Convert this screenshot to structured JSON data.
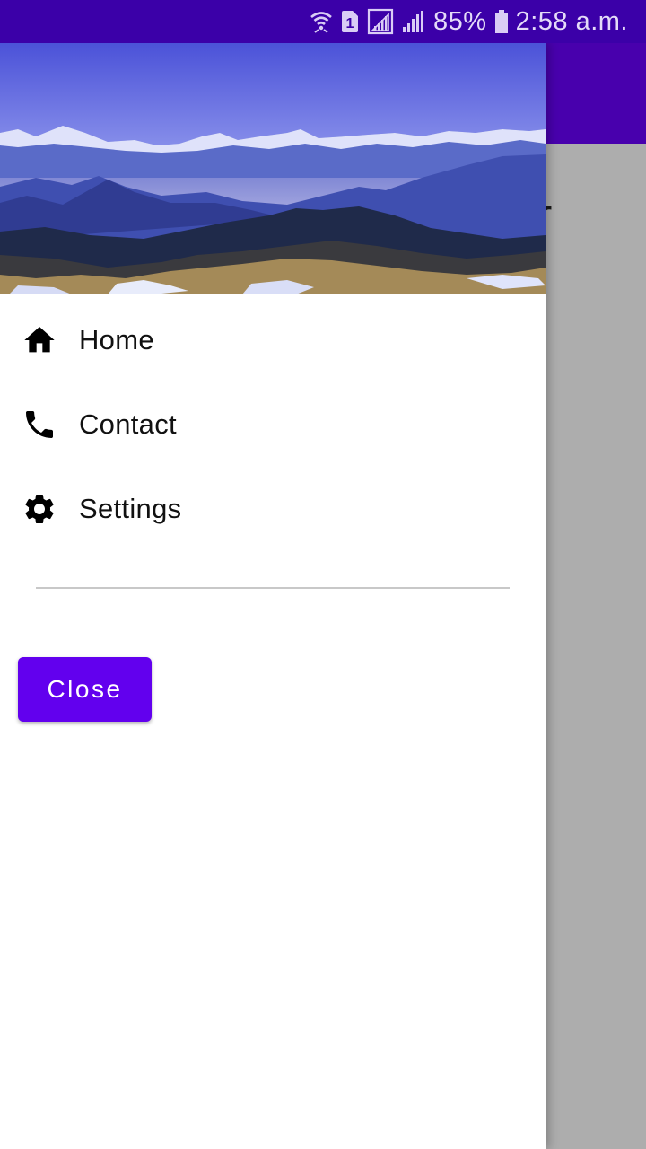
{
  "status_bar": {
    "icons": [
      "wifi-icon",
      "sim-1-icon",
      "signal-icon",
      "signal-icon",
      "battery-icon"
    ],
    "sim_label": "1",
    "battery_percent": "85%",
    "time": "2:58 a.m."
  },
  "background_app": {
    "peek_text": "r"
  },
  "drawer": {
    "header_image": "mountain-landscape",
    "items": [
      {
        "label": "Home",
        "icon": "home-icon"
      },
      {
        "label": "Contact",
        "icon": "phone-icon"
      },
      {
        "label": "Settings",
        "icon": "gear-icon"
      }
    ],
    "close_label": "Close"
  },
  "colors": {
    "status_bar": "#3b00a8",
    "app_bar": "#4800ad",
    "scrim": "#adadad",
    "button": "#6200ee"
  }
}
